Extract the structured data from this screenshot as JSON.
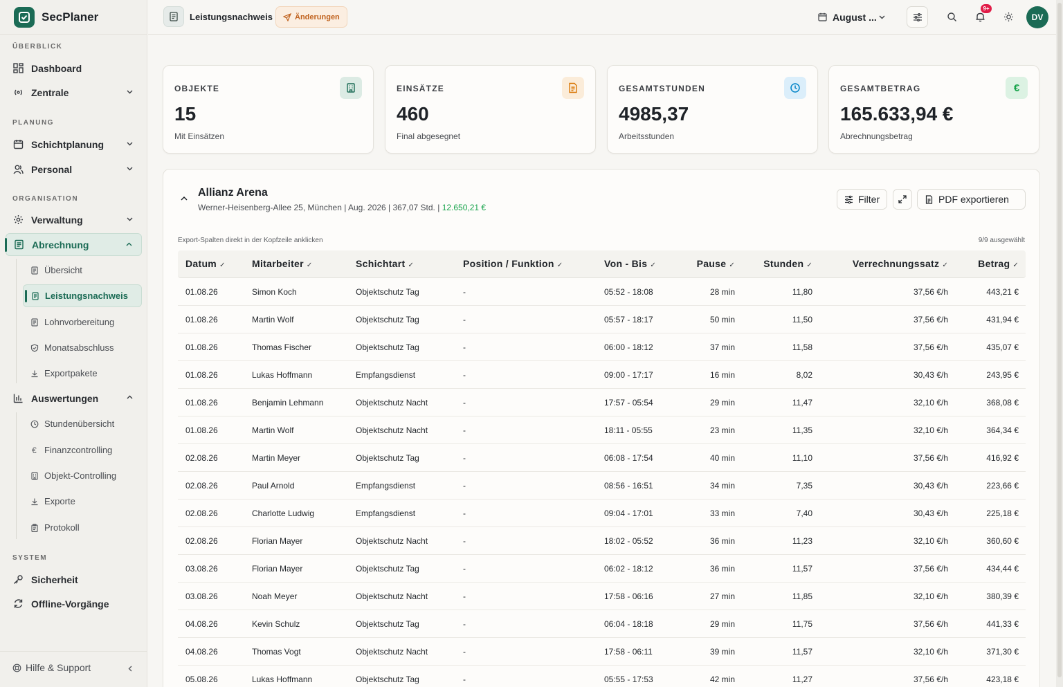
{
  "app": {
    "name": "SecPlaner"
  },
  "sidebar": {
    "sections": [
      {
        "label": "ÜBERBLICK"
      },
      {
        "label": "PLANUNG"
      },
      {
        "label": "ORGANISATION"
      },
      {
        "label": "SYSTEM"
      }
    ],
    "items": [
      {
        "label": "Dashboard",
        "icon": "grid-icon"
      },
      {
        "label": "Zentrale",
        "icon": "radio-icon"
      },
      {
        "label": "Schichtplanung",
        "icon": "calendar-icon"
      },
      {
        "label": "Personal",
        "icon": "users-icon"
      },
      {
        "label": "Verwaltung",
        "icon": "gear-icon"
      },
      {
        "label": "Abrechnung",
        "icon": "document-icon"
      },
      {
        "label": "Auswertungen",
        "icon": "bar-chart-icon"
      },
      {
        "label": "Sicherheit",
        "icon": "key-icon"
      },
      {
        "label": "Offline-Vorgänge",
        "icon": "sync-icon"
      }
    ],
    "abrechnung_sub": [
      {
        "label": "Übersicht",
        "icon": "document-icon"
      },
      {
        "label": "Leistungsnachweis",
        "icon": "document-icon"
      },
      {
        "label": "Lohnvorbereitung",
        "icon": "document-icon"
      },
      {
        "label": "Monatsabschluss",
        "icon": "shield-icon"
      },
      {
        "label": "Exportpakete",
        "icon": "download-icon"
      }
    ],
    "auswertungen_sub": [
      {
        "label": "Stundenübersicht",
        "icon": "clock-icon"
      },
      {
        "label": "Finanzcontrolling",
        "icon": "euro-icon"
      },
      {
        "label": "Objekt-Controlling",
        "icon": "building-icon"
      },
      {
        "label": "Exporte",
        "icon": "download-icon"
      },
      {
        "label": "Protokoll",
        "icon": "clipboard-icon"
      }
    ],
    "help_label": "Hilfe & Support"
  },
  "topbar": {
    "page_title": "Leistungsnachweis",
    "changes_label": "Änderungen",
    "month_label": "August ...",
    "notification_badge": "9+",
    "avatar_initials": "DV"
  },
  "stats": [
    {
      "label": "OBJEKTE",
      "value": "15",
      "sub": "Mit Einsätzen",
      "icon": "building-icon",
      "accent": "#1b6b55",
      "bg": "#dcebe4"
    },
    {
      "label": "EINSÄTZE",
      "value": "460",
      "sub": "Final abgesegnet",
      "icon": "document-icon",
      "accent": "#d97706",
      "bg": "#fbecd9"
    },
    {
      "label": "GESAMTSTUNDEN",
      "value": "4985,37",
      "sub": "Arbeitsstunden",
      "icon": "clock-icon",
      "accent": "#0284c7",
      "bg": "#dbeefa"
    },
    {
      "label": "GESAMTBETRAG",
      "value": "165.633,94 €",
      "sub": "Abrechnungsbetrag",
      "icon": "euro-icon",
      "accent": "#16a34a",
      "bg": "#dcf2e3"
    }
  ],
  "object": {
    "title": "Allianz Arena",
    "meta": "Werner-Heisenberg-Allee 25, München | Aug. 2026 | 367,07 Std. | ",
    "amount": "12.650,21 €"
  },
  "buttons": {
    "filter": "Filter",
    "pdf_export": "PDF exportieren"
  },
  "table": {
    "hint": "Export-Spalten direkt in der Kopfzeile anklicken",
    "selected": "9/9 ausgewählt",
    "headers": {
      "datum": "Datum",
      "mitarbeiter": "Mitarbeiter",
      "schichtart": "Schichtart",
      "position": "Position / Funktion",
      "von_bis": "Von - Bis",
      "pause": "Pause",
      "stunden": "Stunden",
      "satz": "Verrechnungssatz",
      "betrag": "Betrag"
    },
    "rows": [
      [
        "01.08.26",
        "Simon Koch",
        "Objektschutz Tag",
        "-",
        "05:52 - 18:08",
        "28 min",
        "11,80",
        "37,56 €/h",
        "443,21 €"
      ],
      [
        "01.08.26",
        "Martin Wolf",
        "Objektschutz Tag",
        "-",
        "05:57 - 18:17",
        "50 min",
        "11,50",
        "37,56 €/h",
        "431,94 €"
      ],
      [
        "01.08.26",
        "Thomas Fischer",
        "Objektschutz Tag",
        "-",
        "06:00 - 18:12",
        "37 min",
        "11,58",
        "37,56 €/h",
        "435,07 €"
      ],
      [
        "01.08.26",
        "Lukas Hoffmann",
        "Empfangsdienst",
        "-",
        "09:00 - 17:17",
        "16 min",
        "8,02",
        "30,43 €/h",
        "243,95 €"
      ],
      [
        "01.08.26",
        "Benjamin Lehmann",
        "Objektschutz Nacht",
        "-",
        "17:57 - 05:54",
        "29 min",
        "11,47",
        "32,10 €/h",
        "368,08 €"
      ],
      [
        "01.08.26",
        "Martin Wolf",
        "Objektschutz Nacht",
        "-",
        "18:11 - 05:55",
        "23 min",
        "11,35",
        "32,10 €/h",
        "364,34 €"
      ],
      [
        "02.08.26",
        "Martin Meyer",
        "Objektschutz Tag",
        "-",
        "06:08 - 17:54",
        "40 min",
        "11,10",
        "37,56 €/h",
        "416,92 €"
      ],
      [
        "02.08.26",
        "Paul Arnold",
        "Empfangsdienst",
        "-",
        "08:56 - 16:51",
        "34 min",
        "7,35",
        "30,43 €/h",
        "223,66 €"
      ],
      [
        "02.08.26",
        "Charlotte Ludwig",
        "Empfangsdienst",
        "-",
        "09:04 - 17:01",
        "33 min",
        "7,40",
        "30,43 €/h",
        "225,18 €"
      ],
      [
        "02.08.26",
        "Florian Mayer",
        "Objektschutz Nacht",
        "-",
        "18:02 - 05:52",
        "36 min",
        "11,23",
        "32,10 €/h",
        "360,60 €"
      ],
      [
        "03.08.26",
        "Florian Mayer",
        "Objektschutz Tag",
        "-",
        "06:02 - 18:12",
        "36 min",
        "11,57",
        "37,56 €/h",
        "434,44 €"
      ],
      [
        "03.08.26",
        "Noah Meyer",
        "Objektschutz Nacht",
        "-",
        "17:58 - 06:16",
        "27 min",
        "11,85",
        "32,10 €/h",
        "380,39 €"
      ],
      [
        "04.08.26",
        "Kevin Schulz",
        "Objektschutz Tag",
        "-",
        "06:04 - 18:18",
        "29 min",
        "11,75",
        "37,56 €/h",
        "441,33 €"
      ],
      [
        "04.08.26",
        "Thomas Vogt",
        "Objektschutz Nacht",
        "-",
        "17:58 - 06:11",
        "39 min",
        "11,57",
        "32,10 €/h",
        "371,30 €"
      ],
      [
        "05.08.26",
        "Lukas Hoffmann",
        "Objektschutz Tag",
        "-",
        "05:55 - 17:53",
        "42 min",
        "11,27",
        "37,56 €/h",
        "423,18 €"
      ]
    ]
  }
}
